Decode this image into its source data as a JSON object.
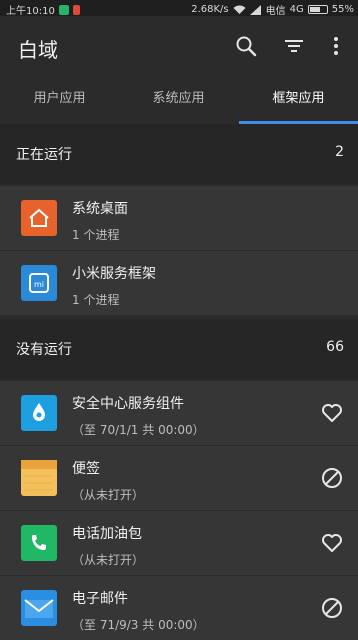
{
  "status": {
    "time": "上午10:10",
    "network_speed": "2.68K/s",
    "carrier": "电信",
    "network_type": "4G",
    "battery": "55%"
  },
  "appbar": {
    "title": "白域"
  },
  "tabs": [
    {
      "label": "用户应用"
    },
    {
      "label": "系统应用"
    },
    {
      "label": "框架应用"
    }
  ],
  "running": {
    "label": "正在运行",
    "count": "2",
    "items": [
      {
        "name": "系统桌面",
        "detail": "1 个进程",
        "icon": "home-icon",
        "color": "#e8632b"
      },
      {
        "name": "小米服务框架",
        "detail": "1 个进程",
        "icon": "mi-icon",
        "color": "#2b8ad8"
      }
    ]
  },
  "not_running": {
    "label": "没有运行",
    "count": "66",
    "items": [
      {
        "name": "安全中心服务组件",
        "detail": "（至 70/1/1 共 00:00）",
        "icon": "water-drop-icon",
        "color": "#1d9fe0",
        "action": "heart-icon"
      },
      {
        "name": "便签",
        "detail": "（从未打开）",
        "icon": "notes-icon",
        "color": "#f3c05c",
        "action": "block-icon"
      },
      {
        "name": "电话加油包",
        "detail": "（从未打开）",
        "icon": "phone-icon",
        "color": "#20b865",
        "action": "heart-icon"
      },
      {
        "name": "电子邮件",
        "detail": "（至 71/9/3 共 00:00）",
        "icon": "mail-icon",
        "color": "#2a8fe0",
        "action": "block-icon"
      }
    ]
  }
}
